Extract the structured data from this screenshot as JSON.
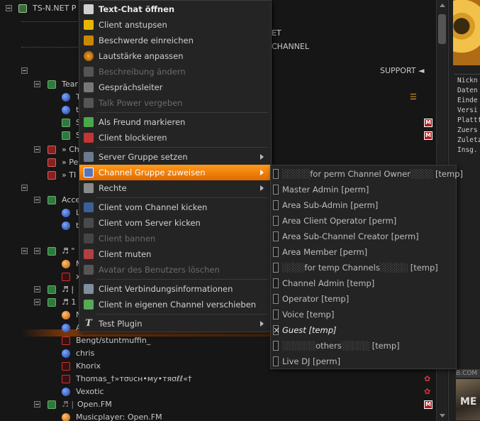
{
  "tree": {
    "server_name": "TS-N.NET P",
    "rows_right_text": [
      "ET",
      "CHANNEL"
    ],
    "support_label": "SUPPORT ◄",
    "items": [
      {
        "label": "Tear"
      },
      {
        "label": "T"
      },
      {
        "label": "t"
      },
      {
        "label": "S"
      },
      {
        "label": "S"
      },
      {
        "label": "» Ch"
      },
      {
        "label": "» Pe"
      },
      {
        "label": "» TI"
      },
      {
        "label": "Acce"
      },
      {
        "label": "L"
      },
      {
        "label": "t"
      },
      {
        "label": "♬ \""
      },
      {
        "label": "M"
      },
      {
        "label": "x"
      },
      {
        "label": "♬ |"
      },
      {
        "label": "♬ 1"
      },
      {
        "label": "N"
      },
      {
        "label": "A"
      },
      {
        "label": "Bengt/stuntmuffin_"
      },
      {
        "label": "chris"
      },
      {
        "label": "Khorix"
      },
      {
        "label": "Thomas_†»тσυcн•мy•тяσℓℓ«†"
      },
      {
        "label": "Vexotic"
      },
      {
        "label": "Open.FM"
      },
      {
        "label": "Musicplayer: Open.FM"
      }
    ]
  },
  "info_panel": {
    "fields": [
      "Nickn",
      "Daten",
      "Einde",
      "Versi",
      "Plattf",
      "Zuers",
      "Zuletz",
      "Insg."
    ],
    "banner_text": "B.COM",
    "banner_big": "ME"
  },
  "context_menu": {
    "items": [
      {
        "label": "Text-Chat öffnen",
        "icon": "chat-icon"
      },
      {
        "label": "Client anstupsen",
        "icon": "poke-icon"
      },
      {
        "label": "Beschwerde einreichen",
        "icon": "complaint-icon"
      },
      {
        "label": "Lautstärke anpassen",
        "icon": "volume-icon"
      },
      {
        "label": "Beschreibung ändern",
        "icon": "description-icon"
      },
      {
        "label": "Gesprächsleiter",
        "icon": "priority-speaker-icon"
      },
      {
        "label": "Talk Power vergeben",
        "icon": "talk-power-icon"
      },
      {
        "label": "Als Freund markieren",
        "icon": "add-friend-icon"
      },
      {
        "label": "Client blockieren",
        "icon": "block-icon"
      },
      {
        "label": "Server Gruppe setzen",
        "icon": "server-group-icon"
      },
      {
        "label": "Channel Gruppe zuweisen",
        "icon": "channel-group-icon"
      },
      {
        "label": "Rechte",
        "icon": "permissions-icon"
      },
      {
        "label": "Client vom Channel kicken",
        "icon": "kick-channel-icon"
      },
      {
        "label": "Client vom Server kicken",
        "icon": "kick-server-icon"
      },
      {
        "label": "Client bannen",
        "icon": "ban-icon"
      },
      {
        "label": "Client muten",
        "icon": "mute-icon"
      },
      {
        "label": "Avatar des Benutzers löschen",
        "icon": "avatar-delete-icon"
      },
      {
        "label": "Client Verbindungsinformationen",
        "icon": "connection-info-icon"
      },
      {
        "label": "Client in eigenen Channel verschieben",
        "icon": "move-client-icon"
      },
      {
        "label": "Test Plugin",
        "icon": "plugin-icon"
      }
    ]
  },
  "submenu": {
    "items": [
      {
        "label": "for perm Channel Owner",
        "suffix": "[temp]"
      },
      {
        "label": "Master Admin [perm]"
      },
      {
        "label": "Area Sub-Admin [perm]"
      },
      {
        "label": "Area Client Operator [perm]"
      },
      {
        "label": "Area Sub-Channel Creator [perm]"
      },
      {
        "label": "Area Member [perm]"
      },
      {
        "label": "for temp Channels",
        "suffix": "[temp]"
      },
      {
        "label": "Channel Admin [temp]"
      },
      {
        "label": "Operator [temp]"
      },
      {
        "label": "Voice [temp]"
      },
      {
        "label": "Guest [temp]",
        "checked": true
      },
      {
        "label": "others",
        "suffix": "[temp]"
      },
      {
        "label": "Live DJ [perm]"
      }
    ]
  },
  "colors": {
    "menu_highlight": "#f08a10",
    "background": "#161616"
  }
}
